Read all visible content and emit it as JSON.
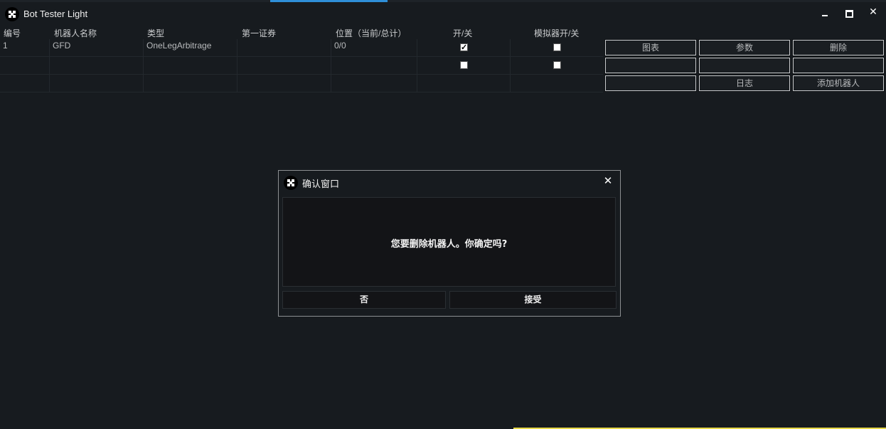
{
  "window": {
    "title": "Bot Tester Light",
    "minimize": "minimize",
    "maximize": "maximize",
    "close": "✕"
  },
  "table": {
    "columns": [
      "编号",
      "机器人名称",
      "类型",
      "第一证券",
      "位置（当前/总计）",
      "开/关",
      "模拟器开/关"
    ],
    "rows": [
      {
        "id": "1",
        "name": "GFD",
        "type": "OneLegArbitrage",
        "security": "",
        "position": "0/0",
        "on_off": true,
        "sim_on_off": false
      },
      {
        "id": "",
        "name": "",
        "type": "",
        "security": "",
        "position": "",
        "on_off": false,
        "sim_on_off": false
      },
      {
        "id": "",
        "name": "",
        "type": "",
        "security": "",
        "position": ""
      }
    ]
  },
  "actions": {
    "row1": [
      "图表",
      "参数",
      "删除"
    ],
    "row2": [
      "",
      "",
      ""
    ],
    "row3": [
      "",
      "日志",
      "添加机器人"
    ]
  },
  "dialog": {
    "title": "确认窗口",
    "close": "✕",
    "message": "您要删除机器人。你确定吗?",
    "no_label": "否",
    "accept_label": "接受"
  },
  "colors": {
    "background": "#171b1f",
    "dialog_body": "#131417",
    "text": "#c9cbcd",
    "accent": "#2f8fd8"
  }
}
